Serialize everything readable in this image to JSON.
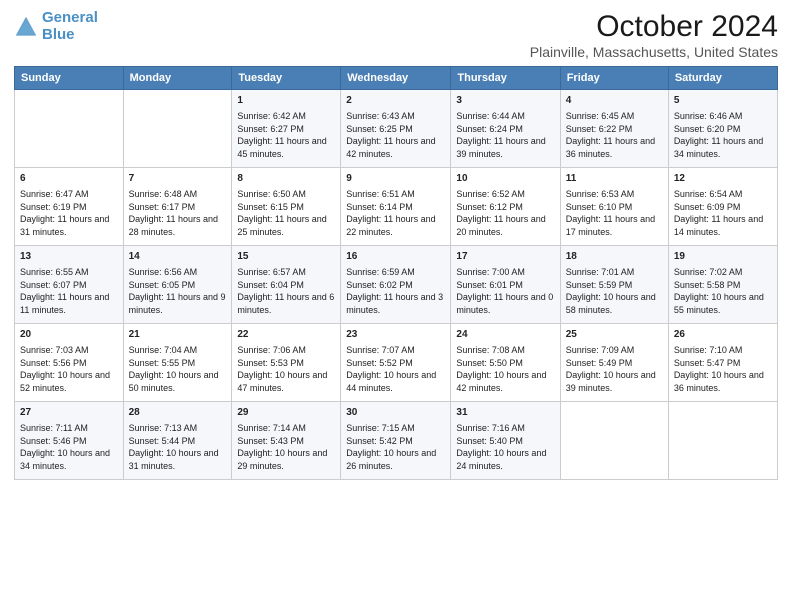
{
  "header": {
    "logo_line1": "General",
    "logo_line2": "Blue",
    "main_title": "October 2024",
    "sub_title": "Plainville, Massachusetts, United States"
  },
  "weekdays": [
    "Sunday",
    "Monday",
    "Tuesday",
    "Wednesday",
    "Thursday",
    "Friday",
    "Saturday"
  ],
  "rows": [
    [
      {
        "day": "",
        "sunrise": "",
        "sunset": "",
        "daylight": ""
      },
      {
        "day": "",
        "sunrise": "",
        "sunset": "",
        "daylight": ""
      },
      {
        "day": "1",
        "sunrise": "Sunrise: 6:42 AM",
        "sunset": "Sunset: 6:27 PM",
        "daylight": "Daylight: 11 hours and 45 minutes."
      },
      {
        "day": "2",
        "sunrise": "Sunrise: 6:43 AM",
        "sunset": "Sunset: 6:25 PM",
        "daylight": "Daylight: 11 hours and 42 minutes."
      },
      {
        "day": "3",
        "sunrise": "Sunrise: 6:44 AM",
        "sunset": "Sunset: 6:24 PM",
        "daylight": "Daylight: 11 hours and 39 minutes."
      },
      {
        "day": "4",
        "sunrise": "Sunrise: 6:45 AM",
        "sunset": "Sunset: 6:22 PM",
        "daylight": "Daylight: 11 hours and 36 minutes."
      },
      {
        "day": "5",
        "sunrise": "Sunrise: 6:46 AM",
        "sunset": "Sunset: 6:20 PM",
        "daylight": "Daylight: 11 hours and 34 minutes."
      }
    ],
    [
      {
        "day": "6",
        "sunrise": "Sunrise: 6:47 AM",
        "sunset": "Sunset: 6:19 PM",
        "daylight": "Daylight: 11 hours and 31 minutes."
      },
      {
        "day": "7",
        "sunrise": "Sunrise: 6:48 AM",
        "sunset": "Sunset: 6:17 PM",
        "daylight": "Daylight: 11 hours and 28 minutes."
      },
      {
        "day": "8",
        "sunrise": "Sunrise: 6:50 AM",
        "sunset": "Sunset: 6:15 PM",
        "daylight": "Daylight: 11 hours and 25 minutes."
      },
      {
        "day": "9",
        "sunrise": "Sunrise: 6:51 AM",
        "sunset": "Sunset: 6:14 PM",
        "daylight": "Daylight: 11 hours and 22 minutes."
      },
      {
        "day": "10",
        "sunrise": "Sunrise: 6:52 AM",
        "sunset": "Sunset: 6:12 PM",
        "daylight": "Daylight: 11 hours and 20 minutes."
      },
      {
        "day": "11",
        "sunrise": "Sunrise: 6:53 AM",
        "sunset": "Sunset: 6:10 PM",
        "daylight": "Daylight: 11 hours and 17 minutes."
      },
      {
        "day": "12",
        "sunrise": "Sunrise: 6:54 AM",
        "sunset": "Sunset: 6:09 PM",
        "daylight": "Daylight: 11 hours and 14 minutes."
      }
    ],
    [
      {
        "day": "13",
        "sunrise": "Sunrise: 6:55 AM",
        "sunset": "Sunset: 6:07 PM",
        "daylight": "Daylight: 11 hours and 11 minutes."
      },
      {
        "day": "14",
        "sunrise": "Sunrise: 6:56 AM",
        "sunset": "Sunset: 6:05 PM",
        "daylight": "Daylight: 11 hours and 9 minutes."
      },
      {
        "day": "15",
        "sunrise": "Sunrise: 6:57 AM",
        "sunset": "Sunset: 6:04 PM",
        "daylight": "Daylight: 11 hours and 6 minutes."
      },
      {
        "day": "16",
        "sunrise": "Sunrise: 6:59 AM",
        "sunset": "Sunset: 6:02 PM",
        "daylight": "Daylight: 11 hours and 3 minutes."
      },
      {
        "day": "17",
        "sunrise": "Sunrise: 7:00 AM",
        "sunset": "Sunset: 6:01 PM",
        "daylight": "Daylight: 11 hours and 0 minutes."
      },
      {
        "day": "18",
        "sunrise": "Sunrise: 7:01 AM",
        "sunset": "Sunset: 5:59 PM",
        "daylight": "Daylight: 10 hours and 58 minutes."
      },
      {
        "day": "19",
        "sunrise": "Sunrise: 7:02 AM",
        "sunset": "Sunset: 5:58 PM",
        "daylight": "Daylight: 10 hours and 55 minutes."
      }
    ],
    [
      {
        "day": "20",
        "sunrise": "Sunrise: 7:03 AM",
        "sunset": "Sunset: 5:56 PM",
        "daylight": "Daylight: 10 hours and 52 minutes."
      },
      {
        "day": "21",
        "sunrise": "Sunrise: 7:04 AM",
        "sunset": "Sunset: 5:55 PM",
        "daylight": "Daylight: 10 hours and 50 minutes."
      },
      {
        "day": "22",
        "sunrise": "Sunrise: 7:06 AM",
        "sunset": "Sunset: 5:53 PM",
        "daylight": "Daylight: 10 hours and 47 minutes."
      },
      {
        "day": "23",
        "sunrise": "Sunrise: 7:07 AM",
        "sunset": "Sunset: 5:52 PM",
        "daylight": "Daylight: 10 hours and 44 minutes."
      },
      {
        "day": "24",
        "sunrise": "Sunrise: 7:08 AM",
        "sunset": "Sunset: 5:50 PM",
        "daylight": "Daylight: 10 hours and 42 minutes."
      },
      {
        "day": "25",
        "sunrise": "Sunrise: 7:09 AM",
        "sunset": "Sunset: 5:49 PM",
        "daylight": "Daylight: 10 hours and 39 minutes."
      },
      {
        "day": "26",
        "sunrise": "Sunrise: 7:10 AM",
        "sunset": "Sunset: 5:47 PM",
        "daylight": "Daylight: 10 hours and 36 minutes."
      }
    ],
    [
      {
        "day": "27",
        "sunrise": "Sunrise: 7:11 AM",
        "sunset": "Sunset: 5:46 PM",
        "daylight": "Daylight: 10 hours and 34 minutes."
      },
      {
        "day": "28",
        "sunrise": "Sunrise: 7:13 AM",
        "sunset": "Sunset: 5:44 PM",
        "daylight": "Daylight: 10 hours and 31 minutes."
      },
      {
        "day": "29",
        "sunrise": "Sunrise: 7:14 AM",
        "sunset": "Sunset: 5:43 PM",
        "daylight": "Daylight: 10 hours and 29 minutes."
      },
      {
        "day": "30",
        "sunrise": "Sunrise: 7:15 AM",
        "sunset": "Sunset: 5:42 PM",
        "daylight": "Daylight: 10 hours and 26 minutes."
      },
      {
        "day": "31",
        "sunrise": "Sunrise: 7:16 AM",
        "sunset": "Sunset: 5:40 PM",
        "daylight": "Daylight: 10 hours and 24 minutes."
      },
      {
        "day": "",
        "sunrise": "",
        "sunset": "",
        "daylight": ""
      },
      {
        "day": "",
        "sunrise": "",
        "sunset": "",
        "daylight": ""
      }
    ]
  ]
}
